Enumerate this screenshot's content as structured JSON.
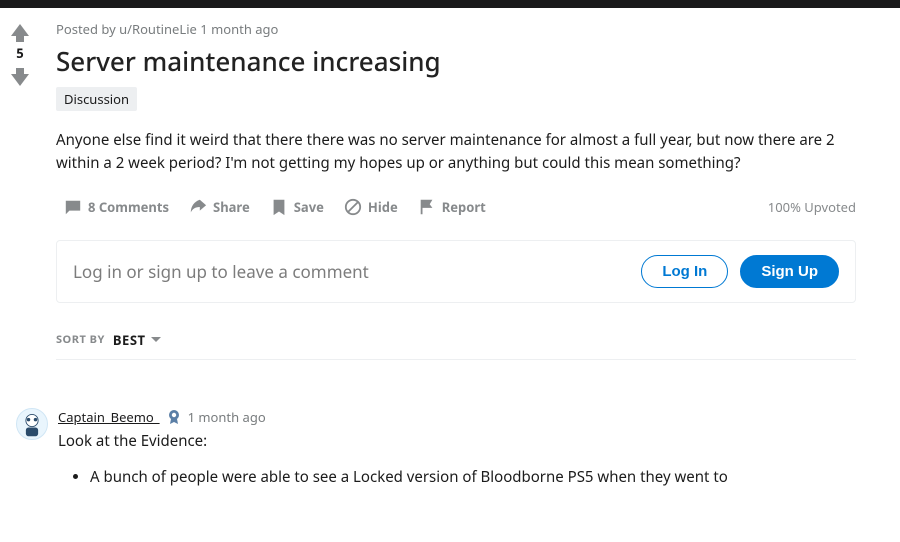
{
  "post": {
    "meta_prefix": "Posted by ",
    "author_prefix": "u/",
    "author": "RoutineLie",
    "age": "1 month ago",
    "score": "5",
    "title": "Server maintenance increasing",
    "flair": "Discussion",
    "body": "Anyone else find it weird that there there was no server maintenance for almost a full year, but now there are 2 within a 2 week period? I'm not getting my hopes up or anything but could this mean something?",
    "upvoted_pct": "100% Upvoted"
  },
  "actions": {
    "comments": "8 Comments",
    "share": "Share",
    "save": "Save",
    "hide": "Hide",
    "report": "Report"
  },
  "login_prompt": {
    "text": "Log in or sign up to leave a comment",
    "login": "Log In",
    "signup": "Sign Up"
  },
  "sort": {
    "label": "Sort by",
    "value": "Best"
  },
  "comment": {
    "author": "Captain_Beemo_",
    "age": "1 month ago",
    "lead": "Look at the Evidence:",
    "bullet1": "A bunch of people were able to see a Locked version of Bloodborne PS5 when they went to"
  }
}
